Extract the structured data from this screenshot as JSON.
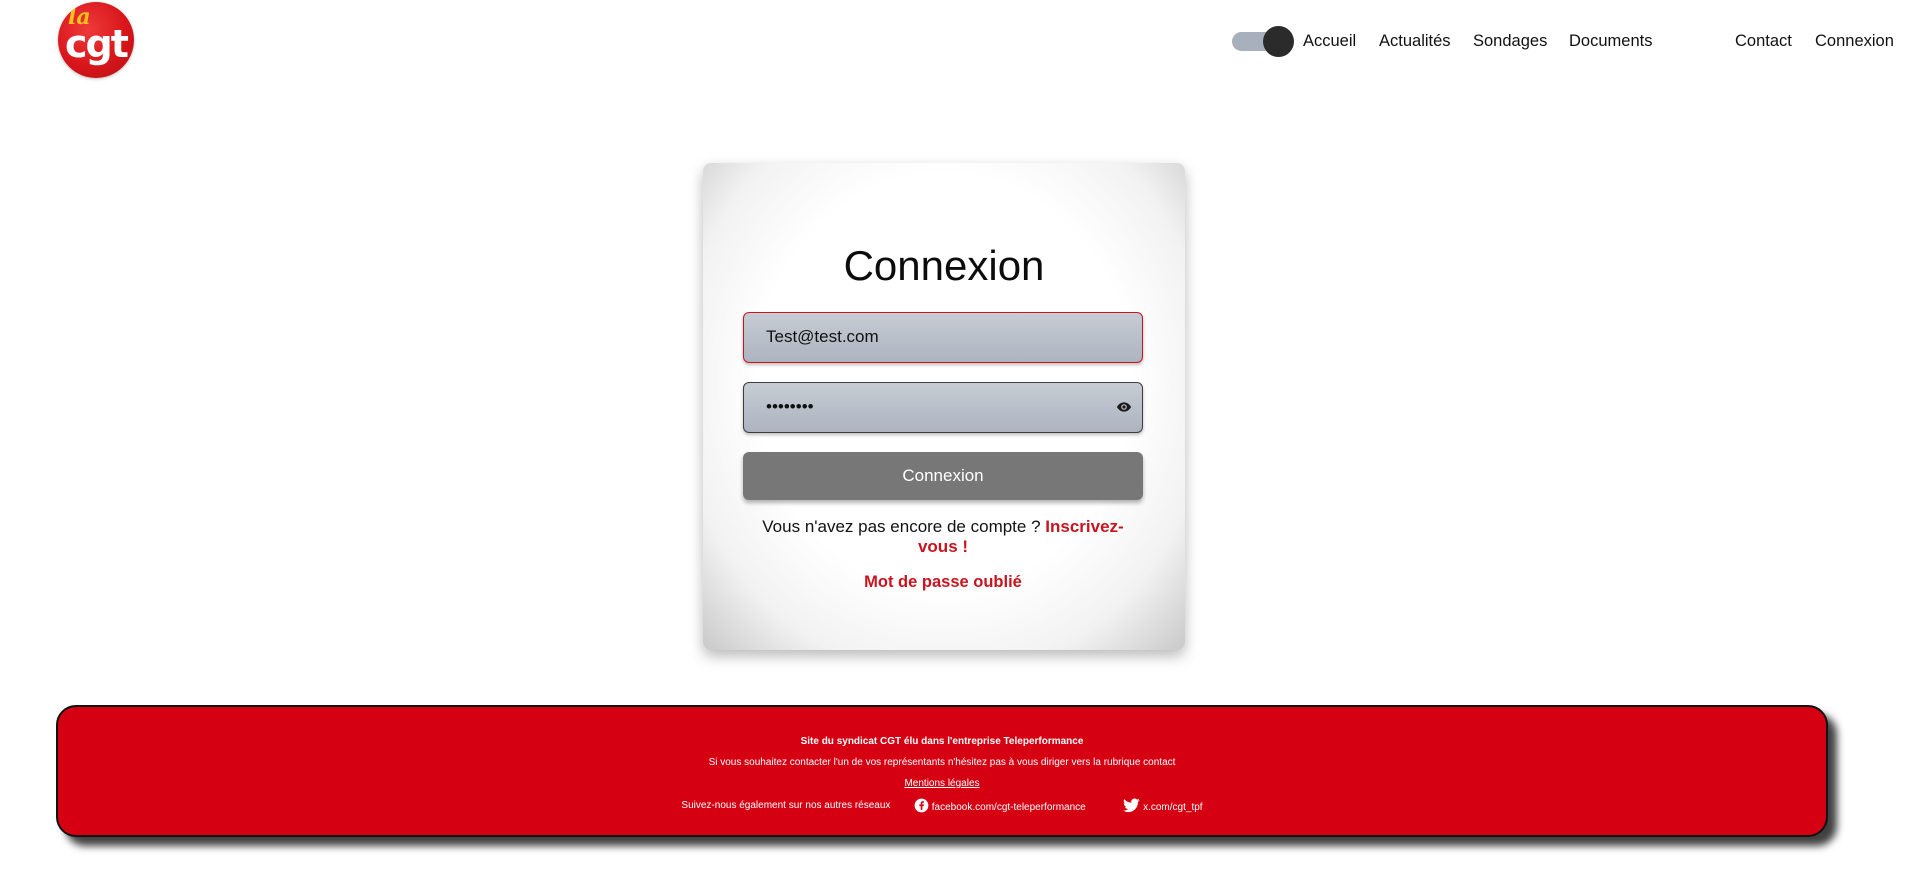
{
  "header": {
    "logo": {
      "small": "la",
      "main": "cgt"
    },
    "theme_toggle": {
      "state": "on"
    },
    "nav": {
      "accueil": "Accueil",
      "actualites": "Actualités",
      "sondages": "Sondages",
      "documents": "Documents",
      "contact": "Contact",
      "connexion": "Connexion"
    }
  },
  "login": {
    "title": "Connexion",
    "email_value": "Test@test.com",
    "password_value": "••••••••",
    "submit_label": "Connexion",
    "signup_prompt": "Vous n'avez pas encore de compte ?",
    "signup_link": "Inscrivez-vous !",
    "forgot_link": "Mot de passe oublié",
    "password_toggle_icon": "eye-icon"
  },
  "footer": {
    "line1": "Site du syndicat CGT élu dans l'entreprise Teleperformance",
    "line2": "Si vous souhaitez contacter l'un de vos représentants n'hésitez pas à vous diriger vers la rubrique contact",
    "legal_link": "Mentions légales",
    "social_intro": "Suivez-nous également sur nos autres réseaux",
    "facebook": "facebook.com/cgt-teleperformance",
    "twitter": "x.com/cgt_tpf",
    "facebook_icon": "facebook-icon",
    "twitter_icon": "twitter-icon"
  },
  "colors": {
    "brand_red": "#d50012",
    "link_red": "#c8141f",
    "button_gray": "#777777",
    "input_bg": "#b9bfc9"
  }
}
